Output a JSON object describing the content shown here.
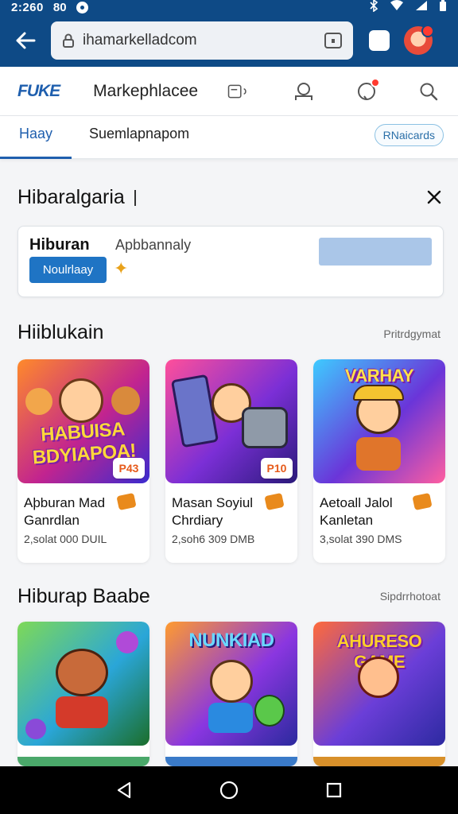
{
  "status_bar": {
    "time": "2:260",
    "extra": "80"
  },
  "browser": {
    "url": "ihamarkelladcom"
  },
  "app_header": {
    "logo": "FUKE",
    "title": "Markephlacee"
  },
  "tabs": {
    "active": "Haay",
    "inactive": "Suemlapnapom",
    "chip": "RNaicards"
  },
  "search_section": {
    "title": "Hibaralgaria"
  },
  "promo": {
    "title": "Hiburan",
    "subtitle": "Apbbannaly",
    "button": "Noulrlaay"
  },
  "section1": {
    "title": "Hiiblukain",
    "see_all": "Pritrdgymat",
    "games": [
      {
        "art_text": "HABUISA BDYIAPOA!",
        "price_tag": "P43",
        "name": "Aþburan Mad Ganrdlan",
        "price": "2,solat 000 DUIL",
        "art_colors": [
          "#ff8a2a",
          "#c2248f",
          "#3a2bd0"
        ]
      },
      {
        "art_text": "",
        "price_tag": "P10",
        "name": "Masan Soyiul Chrdiary",
        "price": "2,soh6 309 DMB",
        "art_colors": [
          "#ff4f9a",
          "#7b2fd6",
          "#2a1a7a"
        ]
      },
      {
        "art_text": "VARHAY",
        "price_tag": "",
        "name": "Aetoall Jalol Kanletan",
        "price": "3,solat 390 DMS",
        "art_colors": [
          "#3ecbff",
          "#6a35d9",
          "#ff5ea0"
        ]
      }
    ]
  },
  "section2": {
    "title": "Hiburap Baabe",
    "see_all": "Sipdrrhotoat",
    "games": [
      {
        "art_text": "",
        "art_colors": [
          "#7ed957",
          "#2aa6d8",
          "#1b6e2a"
        ]
      },
      {
        "art_text": "NUNKIAD",
        "art_colors": [
          "#ff9b2f",
          "#8a36e0",
          "#2b2a9e"
        ]
      },
      {
        "art_text": "AHURESO GAME",
        "art_colors": [
          "#ff6a3a",
          "#6b3ed8",
          "#2d2aa1"
        ]
      }
    ]
  }
}
